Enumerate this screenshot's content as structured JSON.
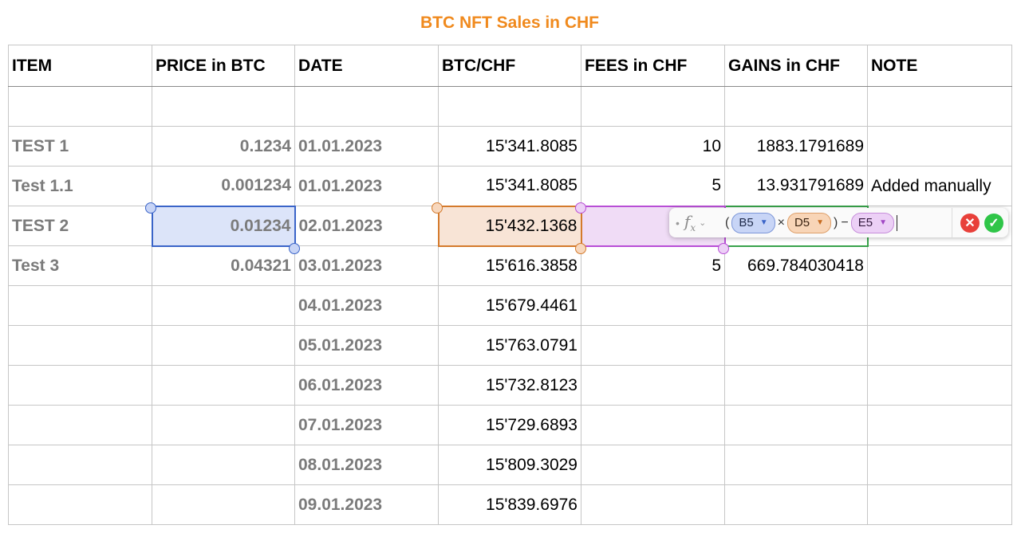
{
  "sheet": {
    "title": "BTC NFT Sales in CHF",
    "columns": [
      "ITEM",
      "PRICE in BTC",
      "DATE",
      "BTC/CHF",
      "FEES in CHF",
      "GAINS in CHF",
      "NOTE"
    ],
    "rows": [
      [
        "",
        "",
        "",
        "",
        "",
        "",
        ""
      ],
      [
        "TEST 1",
        "0.1234",
        "01.01.2023",
        "15'341.8085",
        "10",
        "1883.1791689",
        ""
      ],
      [
        "Test 1.1",
        "0.001234",
        "01.01.2023",
        "15'341.8085",
        "5",
        "13.931791689",
        "Added manually"
      ],
      [
        "TEST 2",
        "0.01234",
        "02.01.2023",
        "15'432.1368",
        "",
        "",
        ""
      ],
      [
        "Test 3",
        "0.04321",
        "03.01.2023",
        "15'616.3858",
        "5",
        "669.784030418",
        ""
      ],
      [
        "",
        "",
        "04.01.2023",
        "15'679.4461",
        "",
        "",
        ""
      ],
      [
        "",
        "",
        "05.01.2023",
        "15'763.0791",
        "",
        "",
        ""
      ],
      [
        "",
        "",
        "06.01.2023",
        "15'732.8123",
        "",
        "",
        ""
      ],
      [
        "",
        "",
        "07.01.2023",
        "15'729.6893",
        "",
        "",
        ""
      ],
      [
        "",
        "",
        "08.01.2023",
        "15'809.3029",
        "",
        "",
        ""
      ],
      [
        "",
        "",
        "09.01.2023",
        "15'839.6976",
        "",
        "",
        ""
      ]
    ]
  },
  "formula_bar": {
    "bullet": "•",
    "fx_label": "f",
    "fx_sub": "x",
    "chevron": "⌄",
    "open_paren": "(",
    "token_1": "B5",
    "op_1": "×",
    "token_2": "D5",
    "close_paren": ")",
    "op_2": "−",
    "token_3": "E5",
    "cancel_icon": "✕",
    "accept_icon": "✓"
  },
  "colors": {
    "title": "#f08a1e",
    "ref_blue": "#3a64c8",
    "ref_orange": "#d47a2c",
    "ref_purple": "#b84ed6",
    "editing_green": "#38a24a"
  }
}
